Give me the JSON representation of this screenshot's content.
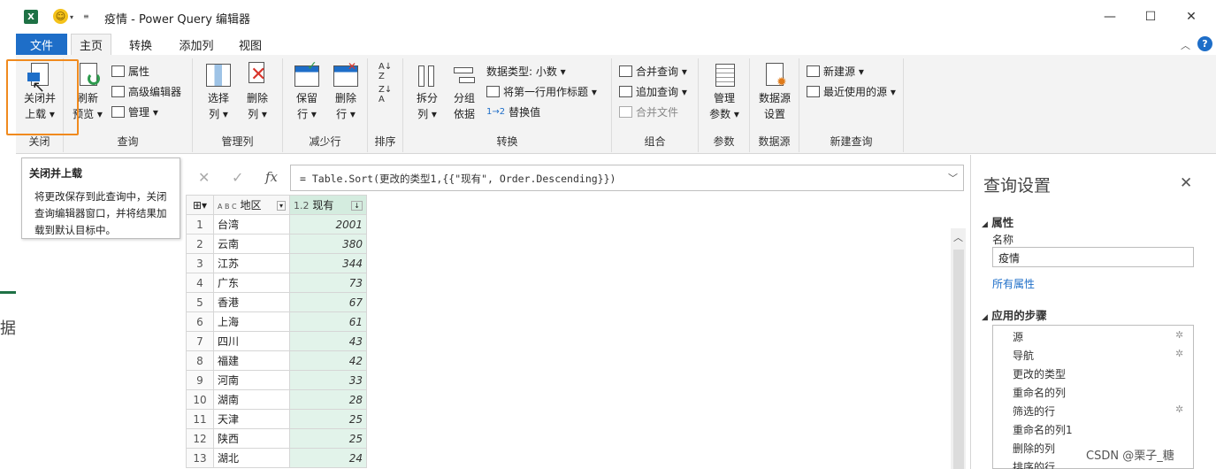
{
  "window": {
    "title": "疫情 - Power Query 编辑器",
    "minimize": "—",
    "restore": "☐",
    "close": "✕"
  },
  "app_icon": "X",
  "tabs": {
    "file": "文件",
    "items": [
      "主页",
      "转换",
      "添加列",
      "视图"
    ],
    "active": "主页"
  },
  "ribbon": {
    "close_group": {
      "label": "关闭",
      "button_line1": "关闭并",
      "button_line2": "上载 ▾"
    },
    "query_group": {
      "label": "查询",
      "refresh_line1": "刷新",
      "refresh_line2": "预览 ▾",
      "properties": "属性",
      "advanced_editor": "高级编辑器",
      "manage": "管理 ▾"
    },
    "manage_cols_group": {
      "label": "管理列",
      "choose_line1": "选择",
      "choose_line2": "列 ▾",
      "remove_line1": "删除",
      "remove_line2": "列 ▾"
    },
    "reduce_rows_group": {
      "label": "减少行",
      "keep_line1": "保留",
      "keep_line2": "行 ▾",
      "remove_line1": "删除",
      "remove_line2": "行 ▾"
    },
    "sort_group": {
      "label": "排序"
    },
    "transform_group": {
      "label": "转换",
      "split_line1": "拆分",
      "split_line2": "列 ▾",
      "group_line1": "分组",
      "group_line2": "依据",
      "data_type": "数据类型: 小数 ▾",
      "first_row_header": "将第一行用作标题 ▾",
      "replace_values": "替换值"
    },
    "combine_group": {
      "label": "组合",
      "merge_queries": "合并查询 ▾",
      "append_queries": "追加查询 ▾",
      "combine_files": "合并文件"
    },
    "params_group": {
      "label": "参数",
      "manage_line1": "管理",
      "manage_line2": "参数 ▾"
    },
    "datasource_group": {
      "label": "数据源",
      "settings_line1": "数据源",
      "settings_line2": "设置"
    },
    "new_query_group": {
      "label": "新建查询",
      "new_source": "新建源 ▾",
      "recent_sources": "最近使用的源 ▾"
    }
  },
  "tooltip": {
    "title": "关闭并上载",
    "body": "将更改保存到此查询中，关闭查询编辑器窗口，并将结果加载到默认目标中。"
  },
  "formula_bar": {
    "cancel": "✕",
    "confirm": "✓",
    "fx": "fx",
    "text": "= Table.Sort(更改的类型1,{{\"现有\", Order.Descending}})"
  },
  "grid": {
    "col1_type": "A B C",
    "col1_header": "地区",
    "col2_type": "1.2",
    "col2_header": "现有",
    "rows": [
      {
        "n": "1",
        "region": "台湾",
        "value": "2001"
      },
      {
        "n": "2",
        "region": "云南",
        "value": "380"
      },
      {
        "n": "3",
        "region": "江苏",
        "value": "344"
      },
      {
        "n": "4",
        "region": "广东",
        "value": "73"
      },
      {
        "n": "5",
        "region": "香港",
        "value": "67"
      },
      {
        "n": "6",
        "region": "上海",
        "value": "61"
      },
      {
        "n": "7",
        "region": "四川",
        "value": "43"
      },
      {
        "n": "8",
        "region": "福建",
        "value": "42"
      },
      {
        "n": "9",
        "region": "河南",
        "value": "33"
      },
      {
        "n": "10",
        "region": "湖南",
        "value": "28"
      },
      {
        "n": "11",
        "region": "天津",
        "value": "25"
      },
      {
        "n": "12",
        "region": "陕西",
        "value": "25"
      },
      {
        "n": "13",
        "region": "湖北",
        "value": "24"
      }
    ]
  },
  "query_settings": {
    "title": "查询设置",
    "properties_section": "属性",
    "name_label": "名称",
    "name_value": "疫情",
    "all_properties": "所有属性",
    "applied_steps_section": "应用的步骤",
    "steps": [
      "源",
      "导航",
      "更改的类型",
      "重命名的列",
      "筛选的行",
      "重命名的列1",
      "删除的列",
      "排序的行"
    ]
  },
  "left_edge_glyph": "据",
  "watermark": "CSDN @栗子_糖"
}
